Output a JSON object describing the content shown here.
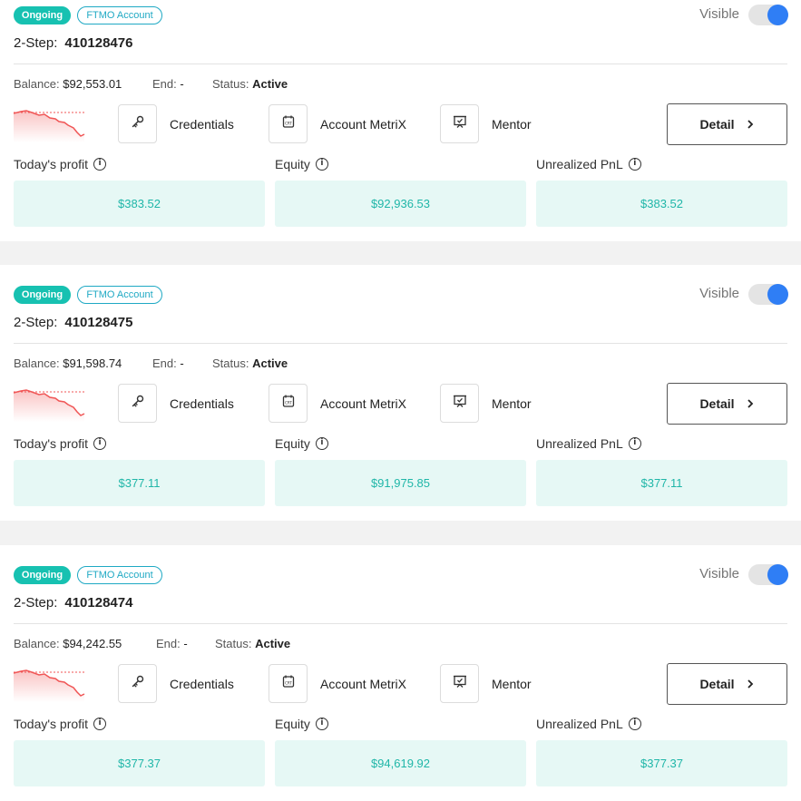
{
  "accounts": [
    {
      "status_badge": "Ongoing",
      "type_badge": "FTMO Account",
      "visible_label": "Visible",
      "visible": true,
      "step": "2-Step:",
      "account_number": "410128476",
      "balance_label": "Balance:",
      "balance": "$92,553.01",
      "end_label": "End:",
      "end": "-",
      "status_label": "Status:",
      "status": "Active",
      "links": {
        "credentials": "Credentials",
        "metrix": "Account MetriX",
        "mentor": "Mentor"
      },
      "detail_label": "Detail",
      "stats": {
        "todays_profit_label": "Today's profit",
        "todays_profit": "$383.52",
        "equity_label": "Equity",
        "equity": "$92,936.53",
        "unrealized_label": "Unrealized PnL",
        "unrealized": "$383.52"
      }
    },
    {
      "status_badge": "Ongoing",
      "type_badge": "FTMO Account",
      "visible_label": "Visible",
      "visible": true,
      "step": "2-Step:",
      "account_number": "410128475",
      "balance_label": "Balance:",
      "balance": "$91,598.74",
      "end_label": "End:",
      "end": "-",
      "status_label": "Status:",
      "status": "Active",
      "links": {
        "credentials": "Credentials",
        "metrix": "Account MetriX",
        "mentor": "Mentor"
      },
      "detail_label": "Detail",
      "stats": {
        "todays_profit_label": "Today's profit",
        "todays_profit": "$377.11",
        "equity_label": "Equity",
        "equity": "$91,975.85",
        "unrealized_label": "Unrealized PnL",
        "unrealized": "$377.11"
      }
    },
    {
      "status_badge": "Ongoing",
      "type_badge": "FTMO Account",
      "visible_label": "Visible",
      "visible": true,
      "step": "2-Step:",
      "account_number": "410128474",
      "balance_label": "Balance:",
      "balance": "$94,242.55",
      "end_label": "End:",
      "end": "-",
      "status_label": "Status:",
      "status": "Active",
      "links": {
        "credentials": "Credentials",
        "metrix": "Account MetriX",
        "mentor": "Mentor"
      },
      "detail_label": "Detail",
      "stats": {
        "todays_profit_label": "Today's profit",
        "todays_profit": "$377.37",
        "equity_label": "Equity",
        "equity": "$94,619.92",
        "unrealized_label": "Unrealized PnL",
        "unrealized": "$377.37"
      }
    }
  ],
  "colors": {
    "ongoing_badge": "#17c1b1",
    "type_badge": "#1fa9c4",
    "toggle_on": "#2f7ef5",
    "stat_bg": "#e6f8f5",
    "stat_text": "#1fb6a8",
    "sparkline": "#f05656"
  },
  "icons": {
    "credentials": "key-icon",
    "metrix": "calendar-icon",
    "mentor": "presentation-icon",
    "detail": "chevron-right-icon",
    "info": "info-icon"
  }
}
